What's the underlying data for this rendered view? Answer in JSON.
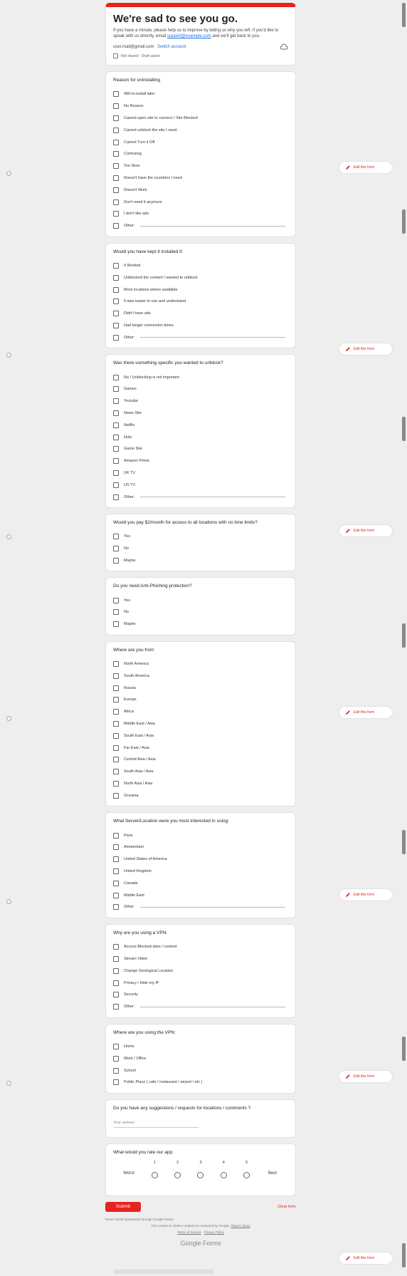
{
  "header": {
    "title": "We're sad to see you go.",
    "description_prefix": "If you have a minute, please help us to improve by telling us why you left. If you'd like to speak with us directly, email",
    "email_link": "support@example.com",
    "description_suffix": "and we'll get back to you.",
    "account_email": "user.mail@gmail.com",
    "switch_label": "Switch account",
    "notice": "Not shared · Draft saved"
  },
  "questions": [
    {
      "title": "Reason for uninstalling",
      "type": "checkbox",
      "options": [
        "Will re-install later",
        "No Reason",
        "Cannot open site to connect / Site Blocked",
        "Cannot unblock the site I need",
        "Cannot Turn it Off",
        "Confusing",
        "Too Slow",
        "Doesn't have the countries I need",
        "Doesn't Work",
        "Don't need it anymore",
        "I don't like ads",
        "Other:"
      ]
    },
    {
      "title": "Would you have kept it installed if:",
      "type": "checkbox",
      "options": [
        "It Worked",
        "Unblocked the content I wanted to unblock",
        "More locations where available",
        "It was easier to use and understand",
        "Didn't have ads",
        "Had longer connection times",
        "Other:"
      ]
    },
    {
      "title": "Was there something specific you wanted to unblock?",
      "type": "checkbox",
      "options": [
        "No / Unblocking is not important",
        "Games",
        "Youtube",
        "News Site",
        "Netflix",
        "Hulu",
        "Game Site",
        "Amazon Prime",
        "UK TV",
        "US TV",
        "Other:"
      ]
    },
    {
      "title": "Would you pay $2/month for access to all locations with no time limits?",
      "type": "checkbox",
      "options": [
        "Yes",
        "No",
        "Maybe"
      ]
    },
    {
      "title": "Do you need Anti-Phishing protection?",
      "type": "checkbox",
      "options": [
        "Yes",
        "No",
        "Maybe"
      ]
    },
    {
      "title": "Where are you from",
      "type": "checkbox",
      "options": [
        "North America",
        "South America",
        "Russia",
        "Europe",
        "Africa",
        "Middle East / Asia",
        "South East / Asia",
        "Far East / Asia",
        "Central Asia / Asia",
        "South Asia / Asia",
        "North Asia / Asia",
        "Oceania"
      ]
    },
    {
      "title": "What Server/Location were you most interested in using:",
      "type": "checkbox",
      "options": [
        "Paris",
        "Amsterdam",
        "United States of America",
        "United Kingdom",
        "Canada",
        "Middle East",
        "Other:"
      ]
    },
    {
      "title": "Why are you using a VPN:",
      "type": "checkbox",
      "options": [
        "Access Blocked sites / content",
        "Stream Video",
        "Change Geological Location",
        "Privacy / Hide my IP",
        "Security",
        "Other:"
      ]
    },
    {
      "title": "Where are you using the VPN:",
      "type": "checkbox",
      "options": [
        "Home",
        "Work / Office",
        "School",
        "Public Place ( cafe / restaurant / airport / etc )"
      ]
    }
  ],
  "suggestions": {
    "title": "Do you have any suggestions / requests for locations / comments ?",
    "placeholder": "Your answer"
  },
  "rating": {
    "title": "What would you rate our app:",
    "low_label": "Worst",
    "high_label": "Best",
    "scale": [
      "1",
      "2",
      "3",
      "4",
      "5"
    ]
  },
  "actions": {
    "submit_label": "Submit",
    "clear_label": "Clear form"
  },
  "footer": {
    "never_submit": "Never submit passwords through Google Forms.",
    "created_line": "This content is neither created nor endorsed by Google.",
    "report_link": "Report Abuse",
    "terms_link": "Terms of Service",
    "privacy_link": "Privacy Policy",
    "google_forms": "Google Forms"
  },
  "side": {
    "edit_label": "Edit this form"
  },
  "colors": {
    "accent": "#e8231d",
    "link": "#1a73e8",
    "background": "#eeeeee"
  }
}
